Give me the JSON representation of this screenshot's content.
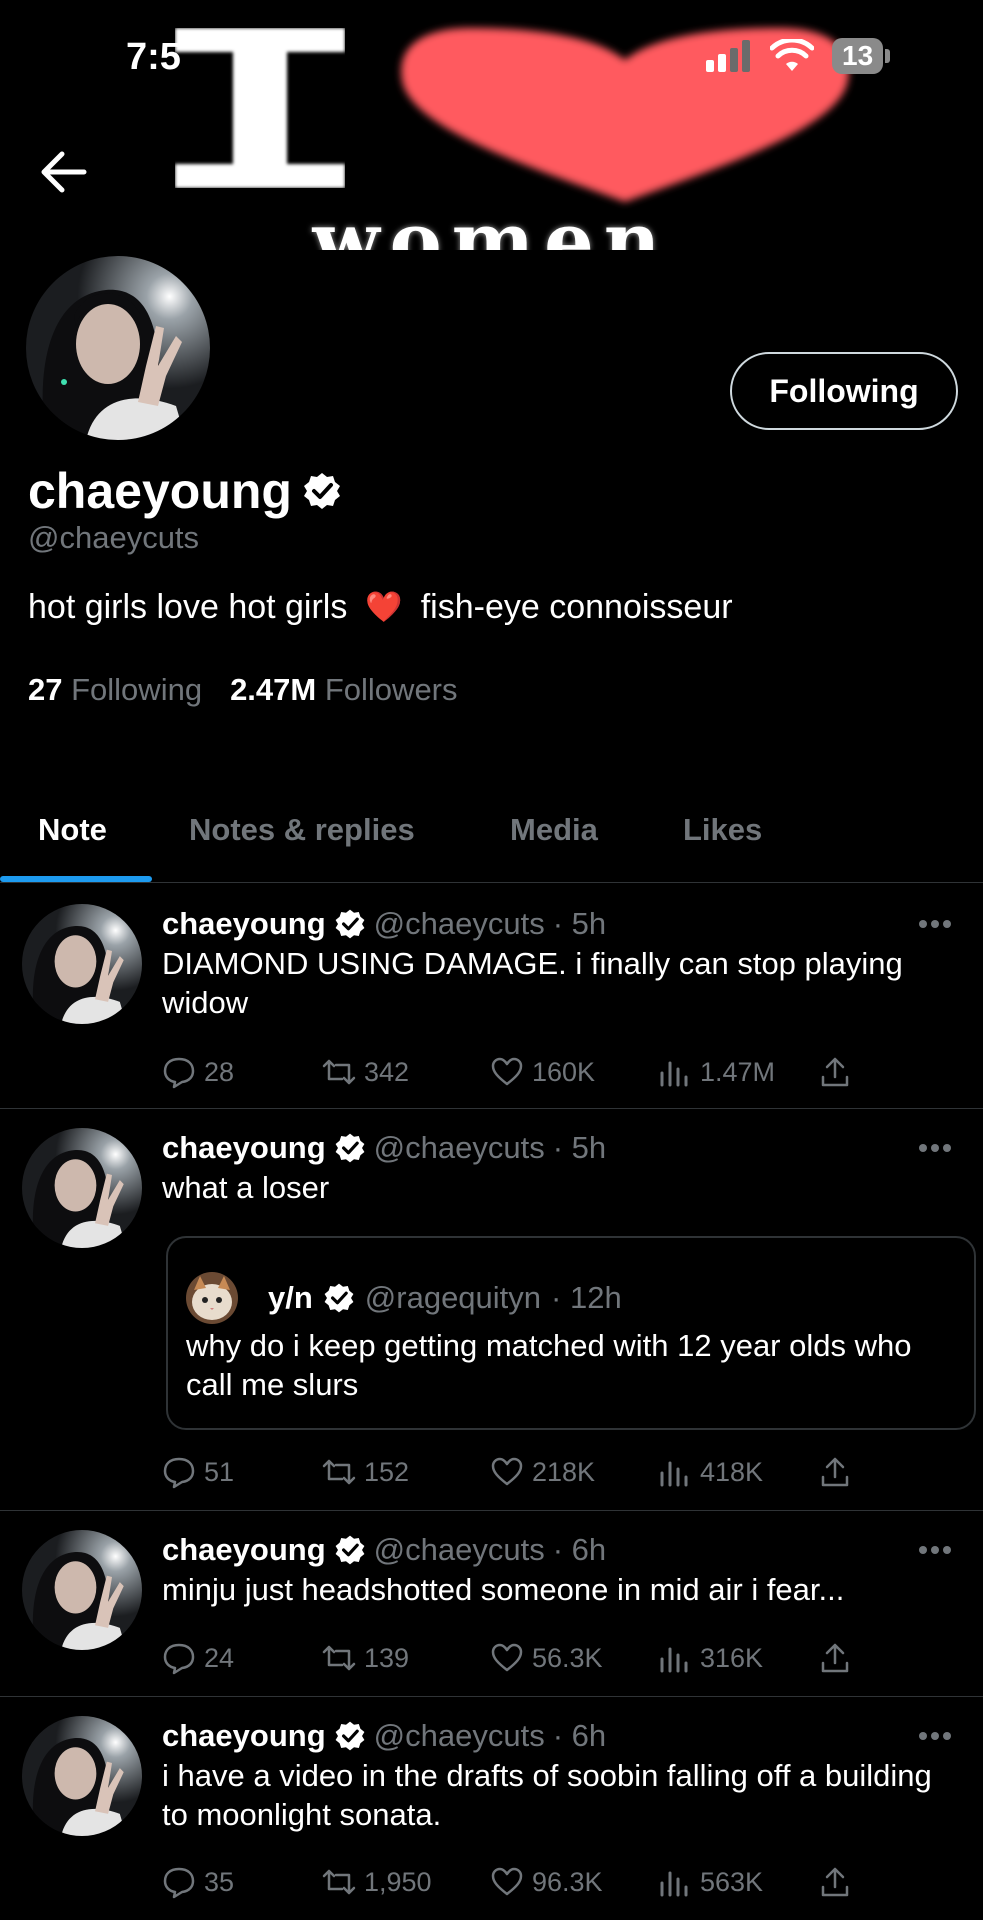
{
  "status_bar": {
    "time": "7:5",
    "battery": "13"
  },
  "banner": {
    "text_top": "I",
    "text_bottom": "women"
  },
  "profile": {
    "name": "chaeyoung",
    "handle": "@chaeycuts",
    "follow_button": "Following",
    "bio_part1": "hot girls love hot girls",
    "bio_emoji": "❤️",
    "bio_part2": "fish-eye connoisseur",
    "following_count": "27",
    "following_label": "Following",
    "followers_count": "2.47M",
    "followers_label": "Followers"
  },
  "tabs": [
    {
      "label": "Note",
      "active": true
    },
    {
      "label": "Notes & replies",
      "active": false
    },
    {
      "label": "Media",
      "active": false
    },
    {
      "label": "Likes",
      "active": false
    }
  ],
  "tweets": [
    {
      "name": "chaeyoung",
      "handle": "@chaeycuts",
      "time": "· 5h",
      "text": "DIAMOND USING DAMAGE. i finally can stop playing widow",
      "replies": "28",
      "retweets": "342",
      "likes": "160K",
      "views": "1.47M"
    },
    {
      "name": "chaeyoung",
      "handle": "@chaeycuts",
      "time": "· 5h",
      "text": "what a loser",
      "quote": {
        "name": "y/n",
        "handle": "@ragequityn",
        "time": "· 12h",
        "text": "why do i keep getting matched with 12 year olds who call me slurs"
      },
      "replies": "51",
      "retweets": "152",
      "likes": "218K",
      "views": "418K"
    },
    {
      "name": "chaeyoung",
      "handle": "@chaeycuts",
      "time": "· 6h",
      "text": "minju just headshotted someone in mid air i fear...",
      "replies": "24",
      "retweets": "139",
      "likes": "56.3K",
      "views": "316K"
    },
    {
      "name": "chaeyoung",
      "handle": "@chaeycuts",
      "time": "· 6h",
      "text": "i have a video in the drafts of soobin falling off a building to moonlight sonata.",
      "replies": "35",
      "retweets": "1,950",
      "likes": "96.3K",
      "views": "563K"
    }
  ],
  "colors": {
    "accent": "#1d9bf0",
    "muted": "#71767b",
    "heart": "#ff5a5f",
    "border": "#2f3336"
  }
}
